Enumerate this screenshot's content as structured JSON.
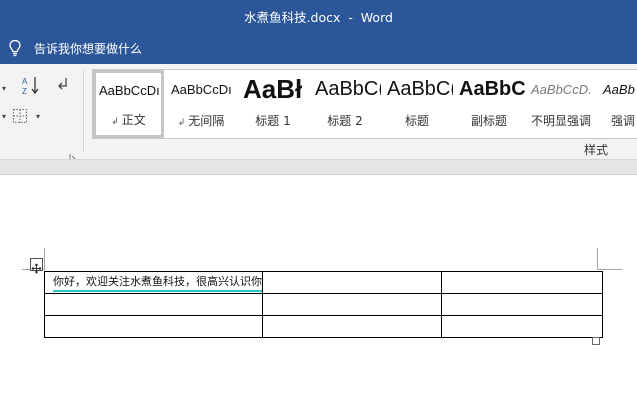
{
  "window": {
    "title": "水煮鱼科技.docx  -  Word"
  },
  "tell_me": {
    "text": "告诉我你想要做什么",
    "icon": "lightbulb-icon"
  },
  "ribbon": {
    "styles_gallery": [
      {
        "preview": "AaBbCcDı",
        "label": "正文",
        "has_mark": true,
        "selected": true
      },
      {
        "preview": "AaBbCcDı",
        "label": "无间隔",
        "has_mark": true,
        "selected": false
      },
      {
        "preview": "AaBł",
        "label": "标题 1",
        "has_mark": false,
        "selected": false
      },
      {
        "preview": "AaBbC(",
        "label": "标题 2",
        "has_mark": false,
        "selected": false
      },
      {
        "preview": "AaBbC(",
        "label": "标题",
        "has_mark": false,
        "selected": false
      },
      {
        "preview": "AaBbC(",
        "label": "副标题",
        "has_mark": false,
        "selected": false
      },
      {
        "preview": "AaBbCcD.",
        "label": "不明显强调",
        "has_mark": false,
        "selected": false
      },
      {
        "preview": "AaBb",
        "label": "强调",
        "has_mark": false,
        "selected": false
      }
    ],
    "styles_group_label": "样式",
    "paragraph_mark": "↲",
    "icons": [
      "sort-icon",
      "show-marks-icon",
      "borders-icon",
      "dialog-launcher-icon"
    ]
  },
  "document": {
    "table": {
      "rows": [
        [
          "你好，欢迎关注水煮鱼科技，很高兴认识你",
          "",
          ""
        ],
        [
          "",
          "",
          ""
        ],
        [
          "",
          "",
          ""
        ]
      ]
    }
  }
}
